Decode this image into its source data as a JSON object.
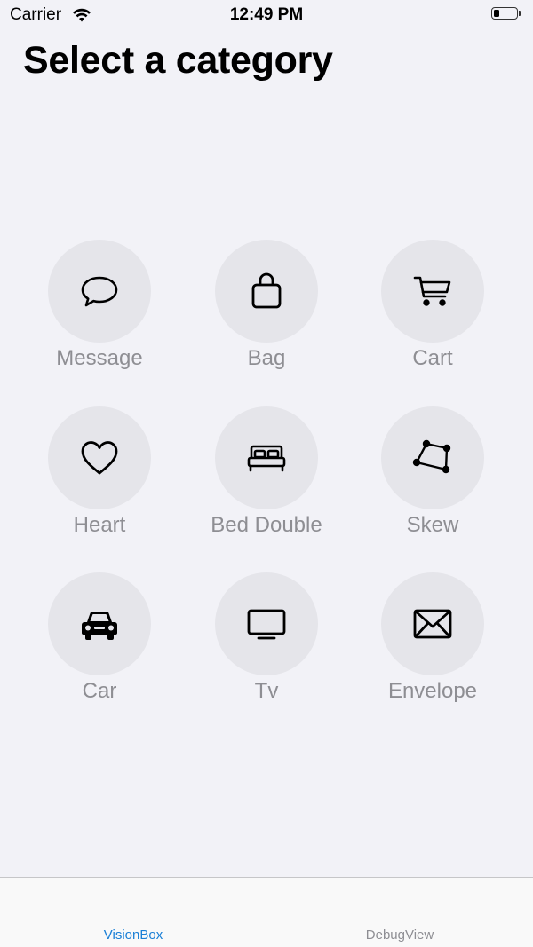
{
  "status_bar": {
    "carrier": "Carrier",
    "time": "12:49 PM",
    "battery_level": 0.25
  },
  "title": "Select a category",
  "categories": [
    {
      "label": "Message",
      "icon": "message-bubble-icon"
    },
    {
      "label": "Bag",
      "icon": "bag-icon"
    },
    {
      "label": "Cart",
      "icon": "cart-icon"
    },
    {
      "label": "Heart",
      "icon": "heart-icon"
    },
    {
      "label": "Bed Double",
      "icon": "bed-double-icon"
    },
    {
      "label": "Skew",
      "icon": "skew-icon"
    },
    {
      "label": "Car",
      "icon": "car-icon"
    },
    {
      "label": "Tv",
      "icon": "tv-icon"
    },
    {
      "label": "Envelope",
      "icon": "envelope-icon"
    }
  ],
  "tab_bar": {
    "tabs": [
      {
        "label": "VisionBox",
        "selected": true
      },
      {
        "label": "DebugView",
        "selected": false
      }
    ],
    "accent_color": "#1a7fd6",
    "inactive_color": "#8e8e93"
  },
  "colors": {
    "background": "#f2f2f7",
    "circle": "#e5e5ea",
    "label": "#8e8e93"
  }
}
